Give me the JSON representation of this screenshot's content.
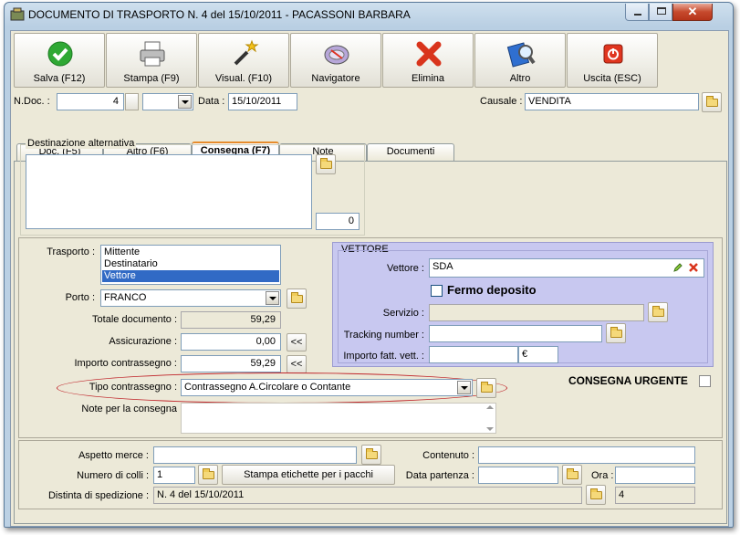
{
  "window": {
    "title": "DOCUMENTO DI TRASPORTO N. 4  del 15/10/2011 - PACASSONI BARBARA"
  },
  "toolbar": [
    {
      "label": "Salva (F12)",
      "icon": "check-icon"
    },
    {
      "label": "Stampa (F9)",
      "icon": "printer-icon"
    },
    {
      "label": "Visual. (F10)",
      "icon": "magic-wand-icon"
    },
    {
      "label": "Navigatore",
      "icon": "navigator-icon"
    },
    {
      "label": "Elimina",
      "icon": "delete-x-icon"
    },
    {
      "label": "Altro",
      "icon": "search-book-icon"
    },
    {
      "label": "Uscita (ESC)",
      "icon": "power-icon"
    }
  ],
  "header": {
    "ndoc_label": "N.Doc. :",
    "ndoc_value": "4",
    "data_label": "Data :",
    "data_value": "15/10/2011",
    "causale_label": "Causale :",
    "causale_value": "VENDITA"
  },
  "tabs": [
    {
      "label": "Doc. (F5)",
      "active": false
    },
    {
      "label": "Altro (F6)",
      "active": false
    },
    {
      "label": "Consegna (F7)",
      "active": true
    },
    {
      "label": "Note",
      "active": false
    },
    {
      "label": "Documenti",
      "active": false
    }
  ],
  "destinazione": {
    "title": "Destinazione alternativa",
    "text": "",
    "count": "0"
  },
  "consegna": {
    "trasporto_label": "Trasporto :",
    "trasporto_options": [
      "Mittente",
      "Destinatario",
      "Vettore"
    ],
    "trasporto_selected": "Vettore",
    "porto_label": "Porto :",
    "porto_value": "FRANCO",
    "totale_label": "Totale documento :",
    "totale_value": "59,29",
    "assicurazione_label": "Assicurazione :",
    "assicurazione_value": "0,00",
    "importo_label": "Importo contrassegno :",
    "importo_value": "59,29",
    "copy_btn": "<<",
    "tipo_label": "Tipo contrassegno :",
    "tipo_value": "Contrassegno A.Circolare o Contante",
    "note_label": "Note per la consegna",
    "note_value": "",
    "urgente_label": "CONSEGNA URGENTE"
  },
  "vettore": {
    "title": "VETTORE",
    "vettore_label": "Vettore :",
    "vettore_value": "SDA",
    "fermo_label": "Fermo deposito",
    "servizio_label": "Servizio :",
    "servizio_value": "",
    "tracking_label": "Tracking number :",
    "tracking_value": "",
    "importo_label": "Importo fatt. vett. :",
    "importo_value": "",
    "currency": "€"
  },
  "bottom": {
    "aspetto_label": "Aspetto merce :",
    "aspetto_value": "",
    "contenuto_label": "Contenuto :",
    "contenuto_value": "",
    "colli_label": "Numero di colli :",
    "colli_value": "1",
    "stampa_etichette": "Stampa etichette per i pacchi",
    "data_partenza_label": "Data partenza :",
    "data_partenza_value": "",
    "ora_label": "Ora :",
    "ora_value": "",
    "distinta_label": "Distinta di spedizione :",
    "distinta_value": "N. 4 del 15/10/2011",
    "distinta_num": "4"
  },
  "colors": {
    "accent_tab": "#e68b2c",
    "vettore_bg": "#c8c8f0",
    "selection": "#316ac5",
    "highlight_ring": "#c0262b"
  }
}
